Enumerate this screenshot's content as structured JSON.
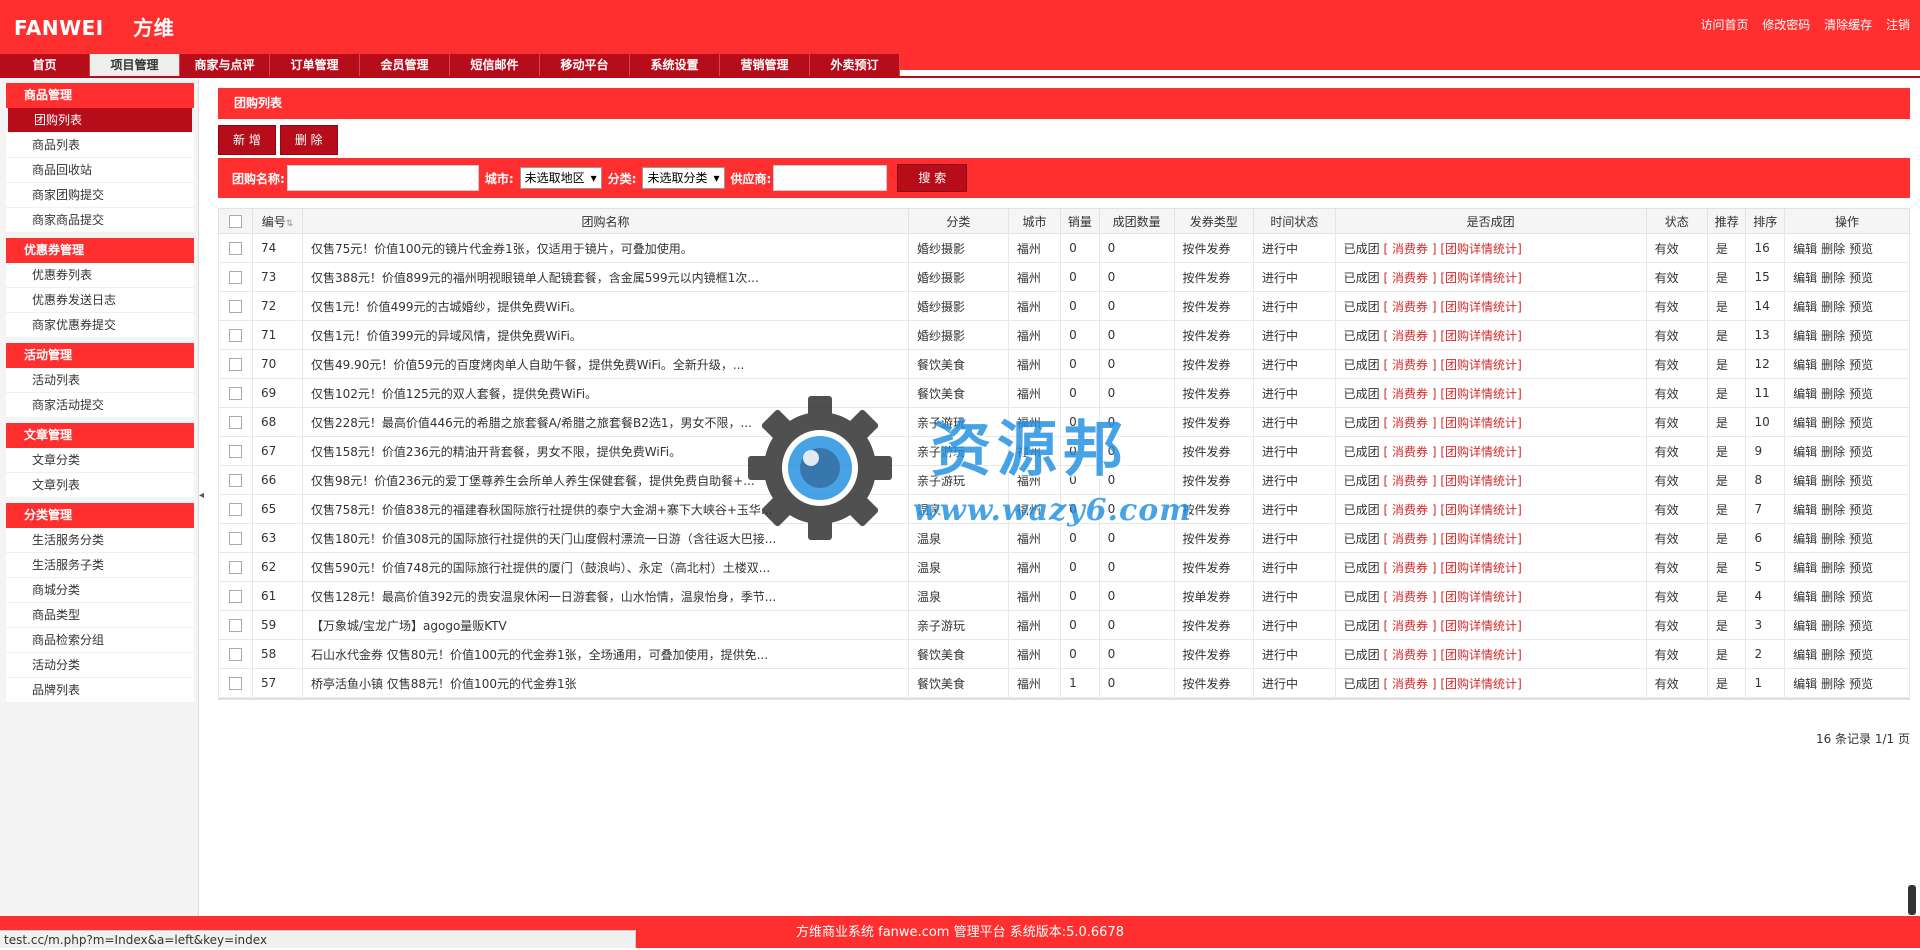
{
  "header": {
    "logo_en": "FANWEI",
    "logo_cn": "方维",
    "links": [
      "访问首页",
      "修改密码",
      "清除缓存",
      "注销"
    ]
  },
  "nav": {
    "tabs": [
      "首页",
      "项目管理",
      "商家与点评",
      "订单管理",
      "会员管理",
      "短信邮件",
      "移动平台",
      "系统设置",
      "营销管理",
      "外卖预订"
    ],
    "active": "项目管理"
  },
  "sidebar": {
    "groups": [
      {
        "title": "商品管理",
        "items": [
          "团购列表",
          "商品列表",
          "商品回收站",
          "商家团购提交",
          "商家商品提交"
        ]
      },
      {
        "title": "优惠券管理",
        "items": [
          "优惠券列表",
          "优惠券发送日志",
          "商家优惠券提交"
        ]
      },
      {
        "title": "活动管理",
        "items": [
          "活动列表",
          "商家活动提交"
        ]
      },
      {
        "title": "文章管理",
        "items": [
          "文章分类",
          "文章列表"
        ]
      },
      {
        "title": "分类管理",
        "items": [
          "生活服务分类",
          "生活服务子类",
          "商城分类",
          "商品类型",
          "商品检索分组",
          "活动分类",
          "品牌列表"
        ]
      }
    ],
    "active_item": "团购列表"
  },
  "panel": {
    "title": "团购列表",
    "add_button": "新 增",
    "delete_button": "删 除"
  },
  "search": {
    "name_label": "团购名称:",
    "name_value": "",
    "city_label": "城市:",
    "city_selected": "未选取地区",
    "category_label": "分类:",
    "category_selected": "未选取分类",
    "supplier_label": "供应商:",
    "supplier_value": "",
    "search_button": "搜 索"
  },
  "table": {
    "headers": [
      "编号",
      "团购名称",
      "分类",
      "城市",
      "销量",
      "成团数量",
      "发券类型",
      "时间状态",
      "是否成团",
      "状态",
      "推荐",
      "排序",
      "操作"
    ],
    "rows": [
      {
        "id": "74",
        "name": "仅售75元！价值100元的镜片代金券1张，仅适用于镜片，可叠加使用。",
        "category": "婚纱摄影",
        "city": "福州",
        "sales": "0",
        "group_count": "0",
        "coupon_type": "按件发券",
        "time_status": "进行中",
        "grouped": "已成团",
        "status": "有效",
        "recommend": "是",
        "sort": "16"
      },
      {
        "id": "73",
        "name": "仅售388元！价值899元的福州明视眼镜单人配镜套餐，含金属599元以内镜框1次...",
        "category": "婚纱摄影",
        "city": "福州",
        "sales": "0",
        "group_count": "0",
        "coupon_type": "按件发券",
        "time_status": "进行中",
        "grouped": "已成团",
        "status": "有效",
        "recommend": "是",
        "sort": "15"
      },
      {
        "id": "72",
        "name": "仅售1元！价值499元的古城婚纱，提供免费WiFi。",
        "category": "婚纱摄影",
        "city": "福州",
        "sales": "0",
        "group_count": "0",
        "coupon_type": "按件发券",
        "time_status": "进行中",
        "grouped": "已成团",
        "status": "有效",
        "recommend": "是",
        "sort": "14"
      },
      {
        "id": "71",
        "name": "仅售1元！价值399元的异域风情，提供免费WiFi。",
        "category": "婚纱摄影",
        "city": "福州",
        "sales": "0",
        "group_count": "0",
        "coupon_type": "按件发券",
        "time_status": "进行中",
        "grouped": "已成团",
        "status": "有效",
        "recommend": "是",
        "sort": "13"
      },
      {
        "id": "70",
        "name": "仅售49.90元！价值59元的百度烤肉单人自助午餐，提供免费WiFi。全新升级，...",
        "category": "餐饮美食",
        "city": "福州",
        "sales": "0",
        "group_count": "0",
        "coupon_type": "按件发券",
        "time_status": "进行中",
        "grouped": "已成团",
        "status": "有效",
        "recommend": "是",
        "sort": "12"
      },
      {
        "id": "69",
        "name": "仅售102元！价值125元的双人套餐，提供免费WiFi。",
        "category": "餐饮美食",
        "city": "福州",
        "sales": "0",
        "group_count": "0",
        "coupon_type": "按件发券",
        "time_status": "进行中",
        "grouped": "已成团",
        "status": "有效",
        "recommend": "是",
        "sort": "11"
      },
      {
        "id": "68",
        "name": "仅售228元！最高价值446元的希腊之旅套餐A/希腊之旅套餐B2选1，男女不限，...",
        "category": "亲子游玩",
        "city": "福州",
        "sales": "0",
        "group_count": "0",
        "coupon_type": "按件发券",
        "time_status": "进行中",
        "grouped": "已成团",
        "status": "有效",
        "recommend": "是",
        "sort": "10"
      },
      {
        "id": "67",
        "name": "仅售158元！价值236元的精油开背套餐，男女不限，提供免费WiFi。",
        "category": "亲子游玩",
        "city": "福州",
        "sales": "0",
        "group_count": "0",
        "coupon_type": "按件发券",
        "time_status": "进行中",
        "grouped": "已成团",
        "status": "有效",
        "recommend": "是",
        "sort": "9"
      },
      {
        "id": "66",
        "name": "仅售98元！价值236元的爱丁堡尊养生会所单人养生保健套餐，提供免费自助餐+...",
        "category": "亲子游玩",
        "city": "福州",
        "sales": "0",
        "group_count": "0",
        "coupon_type": "按件发券",
        "time_status": "进行中",
        "grouped": "已成团",
        "status": "有效",
        "recommend": "是",
        "sort": "8"
      },
      {
        "id": "65",
        "name": "仅售758元！价值838元的福建春秋国际旅行社提供的泰宁大金湖+寨下大峡谷+玉华...",
        "category": "温泉",
        "city": "福州",
        "sales": "0",
        "group_count": "0",
        "coupon_type": "按件发券",
        "time_status": "进行中",
        "grouped": "已成团",
        "status": "有效",
        "recommend": "是",
        "sort": "7"
      },
      {
        "id": "63",
        "name": "仅售180元！价值308元的国际旅行社提供的天门山度假村漂流一日游（含往返大巴接...",
        "category": "温泉",
        "city": "福州",
        "sales": "0",
        "group_count": "0",
        "coupon_type": "按件发券",
        "time_status": "进行中",
        "grouped": "已成团",
        "status": "有效",
        "recommend": "是",
        "sort": "6"
      },
      {
        "id": "62",
        "name": "仅售590元！价值748元的国际旅行社提供的厦门（鼓浪屿）、永定（高北村）土楼双...",
        "category": "温泉",
        "city": "福州",
        "sales": "0",
        "group_count": "0",
        "coupon_type": "按件发券",
        "time_status": "进行中",
        "grouped": "已成团",
        "status": "有效",
        "recommend": "是",
        "sort": "5"
      },
      {
        "id": "61",
        "name": "仅售128元！最高价值392元的贵安温泉休闲一日游套餐，山水怡情，温泉怡身，季节...",
        "category": "温泉",
        "city": "福州",
        "sales": "0",
        "group_count": "0",
        "coupon_type": "按单发券",
        "time_status": "进行中",
        "grouped": "已成团",
        "status": "有效",
        "recommend": "是",
        "sort": "4"
      },
      {
        "id": "59",
        "name": "【万象城/宝龙广场】agogo量贩KTV",
        "category": "亲子游玩",
        "city": "福州",
        "sales": "0",
        "group_count": "0",
        "coupon_type": "按件发券",
        "time_status": "进行中",
        "grouped": "已成团",
        "status": "有效",
        "recommend": "是",
        "sort": "3"
      },
      {
        "id": "58",
        "name": "石山水代金券 仅售80元！价值100元的代金券1张，全场通用，可叠加使用，提供免...",
        "category": "餐饮美食",
        "city": "福州",
        "sales": "0",
        "group_count": "0",
        "coupon_type": "按件发券",
        "time_status": "进行中",
        "grouped": "已成团",
        "status": "有效",
        "recommend": "是",
        "sort": "2"
      },
      {
        "id": "57",
        "name": "桥亭活鱼小镇 仅售88元！价值100元的代金券1张",
        "category": "餐饮美食",
        "city": "福州",
        "sales": "1",
        "group_count": "0",
        "coupon_type": "按件发券",
        "time_status": "进行中",
        "grouped": "已成团",
        "status": "有效",
        "recommend": "是",
        "sort": "1"
      }
    ],
    "link_coupon": "消费券",
    "link_stats": "团购详情统计",
    "ops": [
      "编辑",
      "删除",
      "预览"
    ]
  },
  "pager": "16 条记录 1/1 页",
  "footer": "方维商业系统 fanwe.com 管理平台 系统版本:5.0.6678",
  "statusbar": "test.cc/m.php?m=Index&a=left&key=index",
  "watermark": {
    "text": "资源邦",
    "url": "www.wazy6.com"
  },
  "colors": {
    "primary": "#ff2f2f",
    "dark_red": "#b70d1a",
    "watermark_blue": "#1f8fe0"
  }
}
